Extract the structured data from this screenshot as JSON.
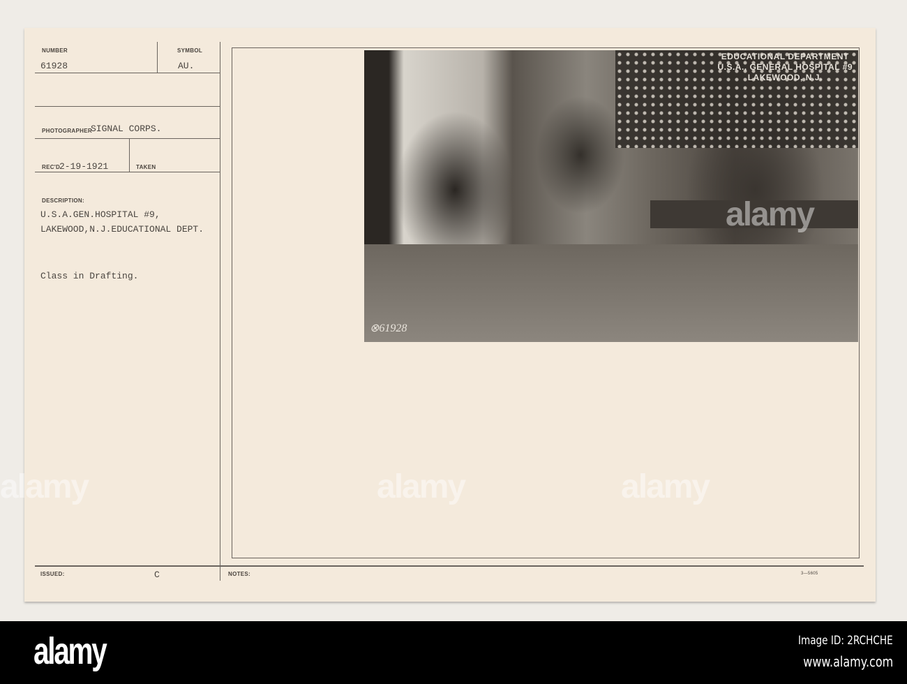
{
  "card": {
    "number_label": "NUMBER",
    "number": "61928",
    "symbol_label": "SYMBOL",
    "symbol": "AU.",
    "photographer_label": "PHOTOGRAPHER",
    "photographer": "SIGNAL CORPS.",
    "recd_label": "REC'D",
    "recd": "2-19-1921",
    "taken_label": "TAKEN",
    "description_label": "DESCRIPTION:",
    "description_line1": "U.S.A.GEN.HOSPITAL #9,",
    "description_line2": "LAKEWOOD,N.J.EDUCATIONAL DEPT.",
    "caption": "Class in Drafting.",
    "issued_label": "ISSUED:",
    "issued": "C",
    "notes_label": "NOTES:",
    "form_code": "3—5605"
  },
  "photo": {
    "caption_lines": [
      "EDUCATIONAL DEPARTMENT",
      "U.S.A., GENERAL HOSPITAL #9",
      "LAKEWOOD, N.J."
    ],
    "negative_number": "⊗61928"
  },
  "watermark": {
    "text": "alamy",
    "image_id": "Image ID: 2RCHCHE",
    "url": "www.alamy.com"
  }
}
